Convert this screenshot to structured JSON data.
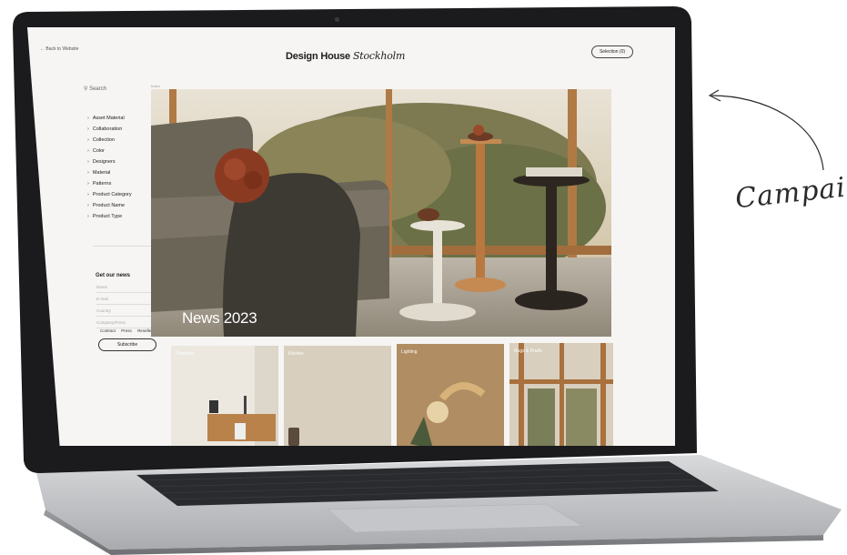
{
  "annotation": {
    "text": "Campai"
  },
  "website": {
    "back_link": "← Back to Website",
    "brand": "Design House",
    "brand_script": "Stockholm",
    "selection_button": "Selection (0)",
    "search_placeholder": "Search",
    "breadcrumb": "Index",
    "filters": [
      {
        "label": "Asset Material"
      },
      {
        "label": "Collaboration"
      },
      {
        "label": "Collection"
      },
      {
        "label": "Color"
      },
      {
        "label": "Designers"
      },
      {
        "label": "Material"
      },
      {
        "label": "Patterns"
      },
      {
        "label": "Product Category"
      },
      {
        "label": "Product Name"
      },
      {
        "label": "Product Type"
      }
    ],
    "newsletter": {
      "title": "Get our news",
      "fields": [
        "Name",
        "E-mail",
        "Country",
        "Company/Press"
      ],
      "roles": [
        "Contract",
        "Press",
        "Resellers"
      ],
      "subscribe_label": "Subscribe"
    },
    "hero": {
      "title": "News 2023"
    },
    "categories": [
      {
        "label": "Furniture"
      },
      {
        "label": "Kitchen"
      },
      {
        "label": "Lighting"
      },
      {
        "label": "Rugs & Poufs"
      }
    ]
  }
}
